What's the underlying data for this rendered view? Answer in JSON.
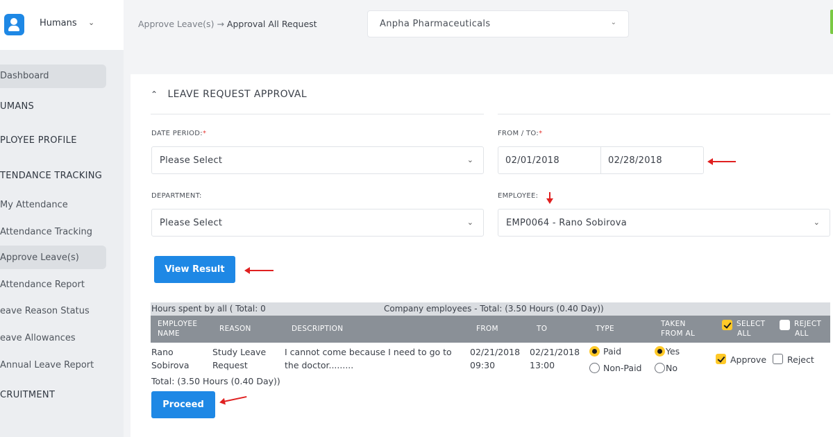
{
  "app": {
    "name": "Humans"
  },
  "breadcrumb": {
    "parent": "Approve Leave(s)",
    "separator": "→",
    "current": "Approval All Request"
  },
  "company": {
    "selected": "Anpha Pharmaceuticals"
  },
  "sidebar": {
    "items": [
      {
        "label": "Dashboard",
        "type": "link"
      },
      {
        "label": "UMANS",
        "type": "section"
      },
      {
        "label": "PLOYEE PROFILE",
        "type": "section"
      },
      {
        "label": "TENDANCE TRACKING",
        "type": "section"
      },
      {
        "label": "My Attendance",
        "type": "link"
      },
      {
        "label": "Attendance Tracking",
        "type": "link"
      },
      {
        "label": "Approve Leave(s)",
        "type": "link",
        "active": true
      },
      {
        "label": "Attendance Report",
        "type": "link"
      },
      {
        "label": "eave Reason Status",
        "type": "link"
      },
      {
        "label": "eave Allowances",
        "type": "link"
      },
      {
        "label": "Annual Leave Report",
        "type": "link"
      },
      {
        "label": "CRUITMENT",
        "type": "section"
      }
    ]
  },
  "form": {
    "title": "LEAVE REQUEST APPROVAL",
    "date_period": {
      "label": "DATE PERIOD:",
      "required": "*",
      "value": "Please Select"
    },
    "from_to": {
      "label": "FROM / TO:",
      "required": "*",
      "from": "02/01/2018",
      "to": "02/28/2018"
    },
    "department": {
      "label": "DEPARTMENT:",
      "value": "Please Select"
    },
    "employee": {
      "label": "EMPLOYEE:",
      "value": "EMP0064 - Rano Sobirova"
    },
    "view_button": "View Result"
  },
  "summary": {
    "hours_all": "Hours spent by all ( Total: 0",
    "company": "Company employees - Total: (3.50 Hours (0.40 Day))"
  },
  "table": {
    "headers": {
      "employee_name": [
        "EMPLOYEE",
        "NAME"
      ],
      "reason": "REASON",
      "description": "DESCRIPTION",
      "from": "FROM",
      "to": "TO",
      "type": "TYPE",
      "taken": [
        "TAKEN",
        "FROM AL"
      ],
      "select_all": [
        "SELECT",
        "ALL"
      ],
      "reject_all": [
        "REJECT",
        "ALL"
      ]
    },
    "rows": [
      {
        "name": [
          "Rano",
          "Sobirova"
        ],
        "reason": [
          "Study Leave",
          "Request"
        ],
        "description": [
          "I cannot come because I need to go to",
          "the doctor........."
        ],
        "from": [
          "02/21/2018",
          "09:30"
        ],
        "to": [
          "02/21/2018",
          "13:00"
        ],
        "type_options": [
          "Paid",
          "Non-Paid"
        ],
        "type_selected": "Paid",
        "taken_options": [
          "Yes",
          "No"
        ],
        "taken_selected": "Yes",
        "approve_label": "Approve",
        "reject_label": "Reject",
        "approved": true
      }
    ],
    "total": "Total: (3.50 Hours (0.40 Day))"
  },
  "proceed_button": "Proceed",
  "colors": {
    "primary": "#1e88e5",
    "accent": "#ffc928",
    "annotation": "#e02020"
  }
}
